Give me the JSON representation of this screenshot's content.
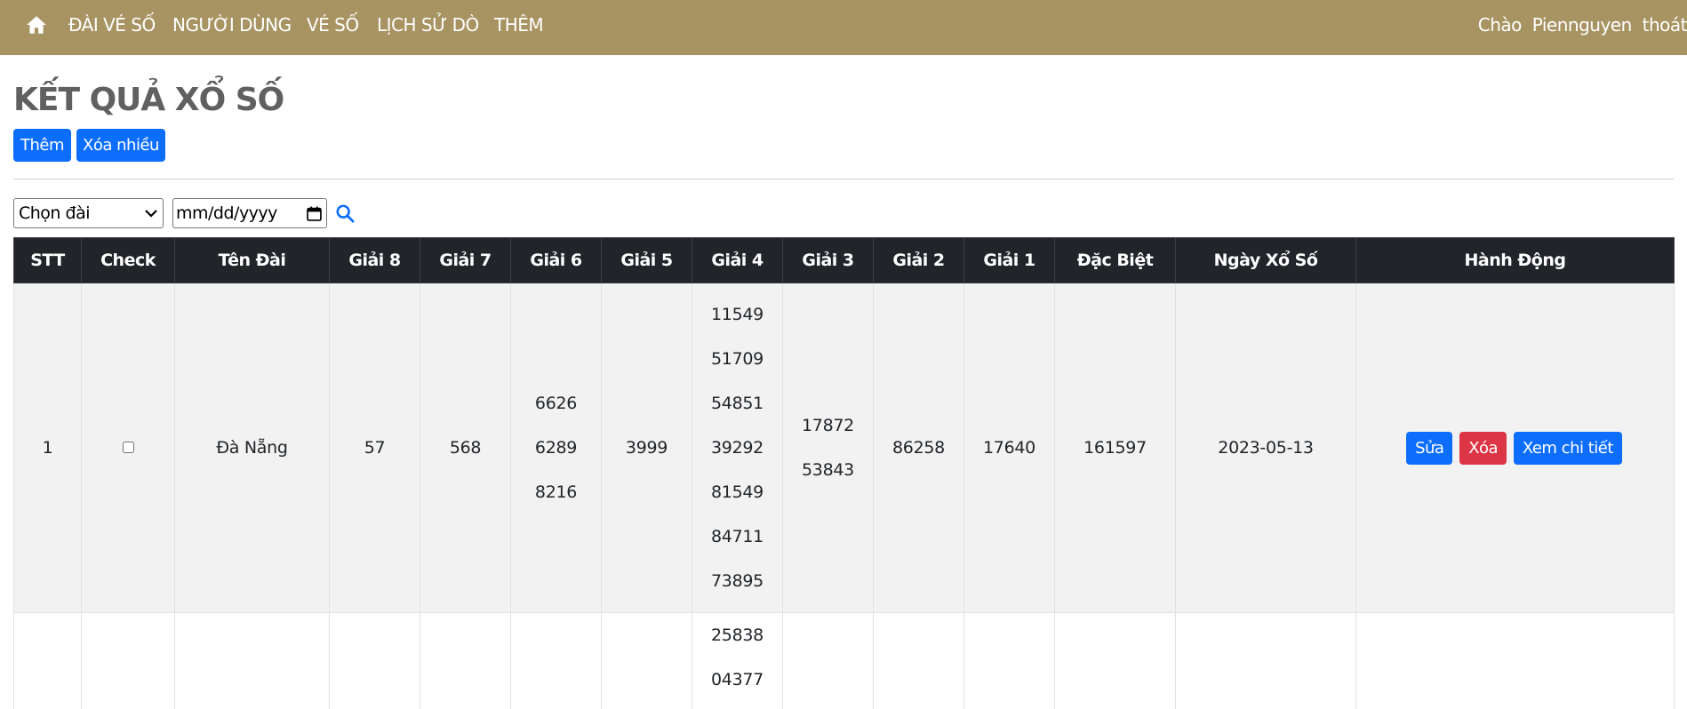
{
  "nav": {
    "items": [
      "ĐÀI VÉ SỐ",
      "NGƯỜI DÙNG",
      "VÉ SỐ",
      "LỊCH SỬ DÒ",
      "THÊM"
    ],
    "greeting": "Chào",
    "username": "Piennguyen",
    "logout": "thoát"
  },
  "page": {
    "title": "KẾT QUẢ XỔ SỐ",
    "add_label": "Thêm",
    "bulk_delete_label": "Xóa nhiều"
  },
  "filters": {
    "station_select": "Chọn đài",
    "date_placeholder": "mm/dd/yyyy"
  },
  "table": {
    "headers": [
      "STT",
      "Check",
      "Tên Đài",
      "Giải 8",
      "Giải 7",
      "Giải 6",
      "Giải 5",
      "Giải 4",
      "Giải 3",
      "Giải 2",
      "Giải 1",
      "Đặc Biệt",
      "Ngày Xổ Số",
      "Hành Động"
    ],
    "rows": [
      {
        "stt": "1",
        "station": "Đà Nẵng",
        "g8": "57",
        "g7": "568",
        "g6": [
          "6626",
          "6289",
          "8216"
        ],
        "g5": "3999",
        "g4": [
          "11549",
          "51709",
          "54851",
          "39292",
          "81549",
          "84711",
          "73895"
        ],
        "g3": [
          "17872",
          "53843"
        ],
        "g2": "86258",
        "g1": "17640",
        "special": "161597",
        "date": "2023-05-13",
        "actions": {
          "edit": "Sửa",
          "delete": "Xóa",
          "detail": "Xem chi tiết"
        }
      },
      {
        "g4": [
          "25838",
          "04377"
        ]
      }
    ]
  },
  "colors": {
    "navbar": "#a89462",
    "primary": "#0d6efd",
    "danger": "#dc3545",
    "table_header": "#212529"
  },
  "icons": [
    "home-icon",
    "chevron-down-icon",
    "calendar-icon",
    "search-icon"
  ]
}
